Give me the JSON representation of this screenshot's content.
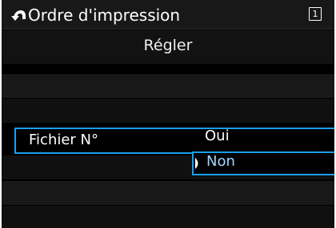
{
  "header": {
    "title": "Ordre d'impression",
    "page_badge": "1",
    "back_icon": "return-arrow-icon"
  },
  "subheader": {
    "title": "Régler"
  },
  "setting": {
    "label": "Fichier N°",
    "options": [
      "Oui",
      "Non"
    ],
    "selected": "Non"
  },
  "colors": {
    "accent": "#1aa0f0",
    "selected_text": "#9fd4ff"
  }
}
